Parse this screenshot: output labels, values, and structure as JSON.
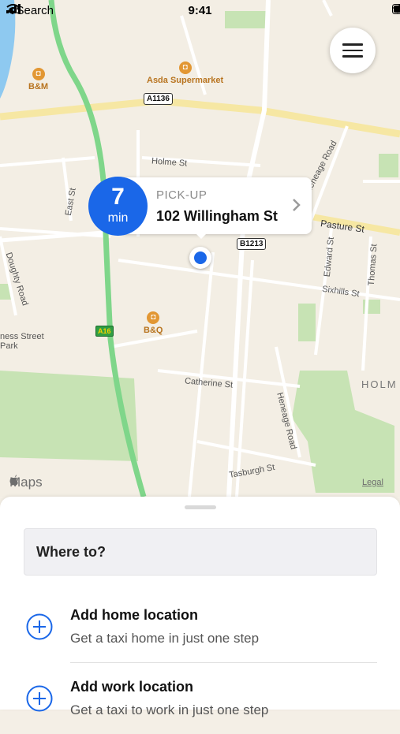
{
  "status_bar": {
    "back_label": "Search",
    "time": "9:41"
  },
  "map": {
    "labels": {
      "poi_bm": "B&M",
      "poi_asda": "Asda Supermarket",
      "poi_bq": "B&Q",
      "road_a1136": "A1136",
      "road_b1213": "B1213",
      "road_a16": "A16",
      "holme_st": "Holme St",
      "east_st": "East St",
      "pasture_st": "Pasture St",
      "heneage_road_top": "Heneage Road",
      "edward_st": "Edward St",
      "thomas_st": "Thomas St",
      "sixhills_st": "Sixhills St",
      "catherine_st": "Catherine St",
      "heneage_road": "Heneage Road",
      "tasburgh_st": "Tasburgh St",
      "doughty_road": "Doughty Road",
      "ness_street_park": "ness Street\nPark",
      "holme_district": "HOLM"
    },
    "maps_attribution": "Maps",
    "legal_link": "Legal"
  },
  "callout": {
    "eta_value": "7",
    "eta_unit": "min",
    "label": "PICK-UP",
    "address": "102 Willingham St"
  },
  "sheet": {
    "where_to": "Where to?",
    "rows": [
      {
        "title": "Add home location",
        "subtitle": "Get a taxi home in just one step"
      },
      {
        "title": "Add work location",
        "subtitle": "Get a taxi to work in just one step"
      }
    ]
  },
  "colors": {
    "accent": "#1a67e8",
    "route_green": "#7fd68a",
    "map_bg": "#f3eee4"
  }
}
